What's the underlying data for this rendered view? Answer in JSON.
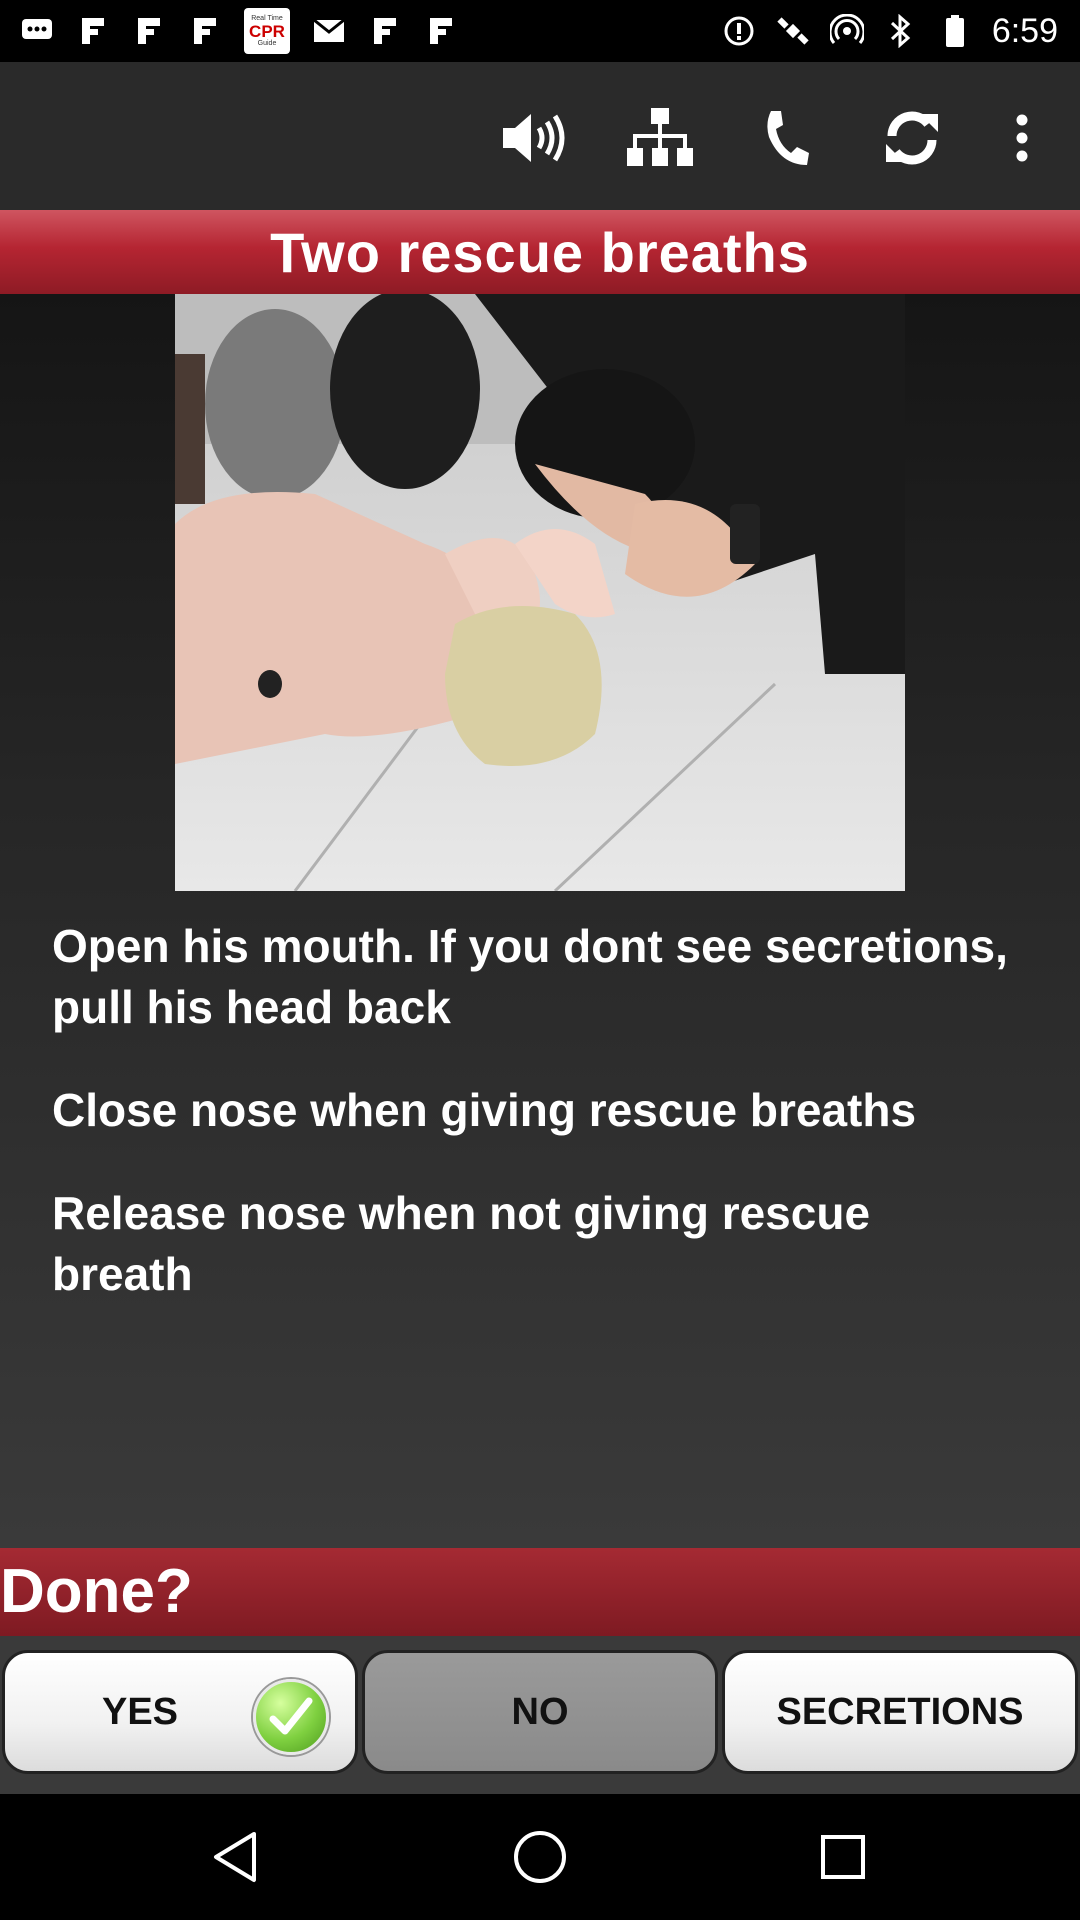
{
  "status_bar": {
    "app_badge": {
      "line1": "Real Time",
      "line2": "CPR",
      "line3": "Guide"
    },
    "time": "6:59",
    "icons": [
      "messages-icon",
      "notification-icon",
      "signal-sat-icon",
      "bluetooth-icon",
      "battery-icon"
    ]
  },
  "action_bar": {
    "icons": [
      "volume-icon",
      "sitemap-icon",
      "phone-icon",
      "refresh-icon",
      "overflow-menu-icon"
    ]
  },
  "title": "Two rescue breaths",
  "instructions": [
    "Open his mouth. If you dont see secretions, pull his head back",
    "Close nose when giving rescue breaths",
    "Release nose when not giving rescue breath"
  ],
  "done": {
    "label": "Done?"
  },
  "buttons": {
    "yes": "YES",
    "no": "NO",
    "secretions": "SECRETIONS"
  },
  "colors": {
    "banner_red": "#b52532",
    "done_red": "#8e1b25",
    "check_green": "#7fd040"
  }
}
